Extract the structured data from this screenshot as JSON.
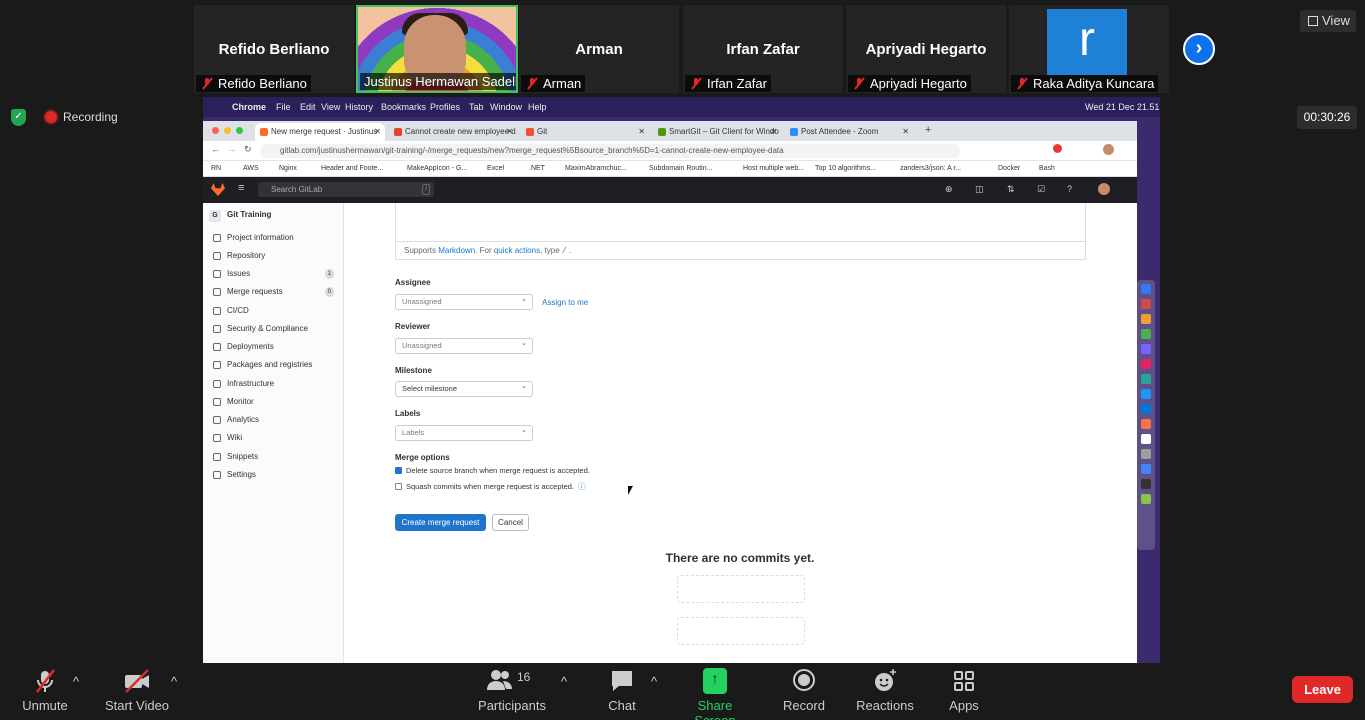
{
  "gallery": [
    {
      "big": "Refido Berliano",
      "name": "Refido Berliano"
    },
    {
      "big": "",
      "name": "Justinus Hermawan Sadeli"
    },
    {
      "big": "Arman",
      "name": "Arman"
    },
    {
      "big": "Irfan Zafar",
      "name": "Irfan Zafar"
    },
    {
      "big": "Apriyadi Hegarto",
      "name": "Apriyadi Hegarto"
    },
    {
      "big": "r",
      "name": "Raka Aditya Kuncara"
    }
  ],
  "view_label": "View",
  "recording_label": "Recording",
  "timer": "00:30:26",
  "mac": {
    "apple": "",
    "app": "Chrome",
    "menus": [
      "File",
      "Edit",
      "View",
      "History",
      "Bookmarks",
      "Profiles",
      "Tab",
      "Window",
      "Help"
    ],
    "clock": "Wed 21 Dec  21.51"
  },
  "tabs": [
    {
      "title": "New merge request · Justinus",
      "color": "#fc6d26"
    },
    {
      "title": "Cannot create new employee d",
      "color": "#e24329"
    },
    {
      "title": "Git",
      "color": "#f05033"
    },
    {
      "title": "SmartGit – Git Client for Windo",
      "color": "#4e9a06"
    },
    {
      "title": "Post Attendee - Zoom",
      "color": "#2d8cff"
    }
  ],
  "url": "gitlab.com/justinushermawan/git-training/-/merge_requests/new?merge_request%5Bsource_branch%5D=1-cannot-create-new-employee-data",
  "bookmarks": [
    "RN",
    "AWS",
    "Nginx",
    "Header and Foote...",
    "MakeAppIcon - G...",
    "Excel",
    ".NET",
    "MaximAbramchuc...",
    "Subdomain Routin...",
    "Host multiple web...",
    "Top 10 algorithms...",
    "zanders3/json: A r...",
    "Docker",
    "Bash"
  ],
  "search_placeholder": "Search GitLab",
  "search_key": "/",
  "project": {
    "letter": "G",
    "name": "Git Training"
  },
  "nav": [
    {
      "label": "Project information",
      "count": ""
    },
    {
      "label": "Repository",
      "count": ""
    },
    {
      "label": "Issues",
      "count": "1"
    },
    {
      "label": "Merge requests",
      "count": "0"
    },
    {
      "label": "CI/CD",
      "count": ""
    },
    {
      "label": "Security & Compliance",
      "count": ""
    },
    {
      "label": "Deployments",
      "count": ""
    },
    {
      "label": "Packages and registries",
      "count": ""
    },
    {
      "label": "Infrastructure",
      "count": ""
    },
    {
      "label": "Monitor",
      "count": ""
    },
    {
      "label": "Analytics",
      "count": ""
    },
    {
      "label": "Wiki",
      "count": ""
    },
    {
      "label": "Snippets",
      "count": ""
    },
    {
      "label": "Settings",
      "count": ""
    }
  ],
  "form": {
    "supports": "Supports ",
    "markdown": "Markdown",
    "for": ". For ",
    "quick_actions": "quick actions",
    "type": ", type ",
    "slash": "/",
    "dot": " .",
    "assignee_label": "Assignee",
    "assignee_value": "Unassigned",
    "assign_to_me": "Assign to me",
    "reviewer_label": "Reviewer",
    "reviewer_value": "Unassigned",
    "milestone_label": "Milestone",
    "milestone_value": "Select milestone",
    "labels_label": "Labels",
    "labels_value": "Labels",
    "merge_options_label": "Merge options",
    "delete_branch": "Delete source branch when merge request is accepted.",
    "delete_branch_checked": true,
    "squash": "Squash commits when merge request is accepted.",
    "squash_checked": false,
    "create_button": "Create merge request",
    "cancel_button": "Cancel",
    "no_commits": "There are no commits yet."
  },
  "toolbar": {
    "unmute": "Unmute",
    "start_video": "Start Video",
    "participants": "Participants",
    "participants_count": "16",
    "chat": "Chat",
    "share_screen": "Share Screen",
    "record": "Record",
    "reactions": "Reactions",
    "apps": "Apps",
    "leave": "Leave"
  },
  "colors": {
    "zoom_bg": "#1a1a1a",
    "gitlab_header": "#1f1e24",
    "primary_blue": "#1f75cb",
    "leave_red": "#e02828",
    "share_green": "#23d160"
  }
}
